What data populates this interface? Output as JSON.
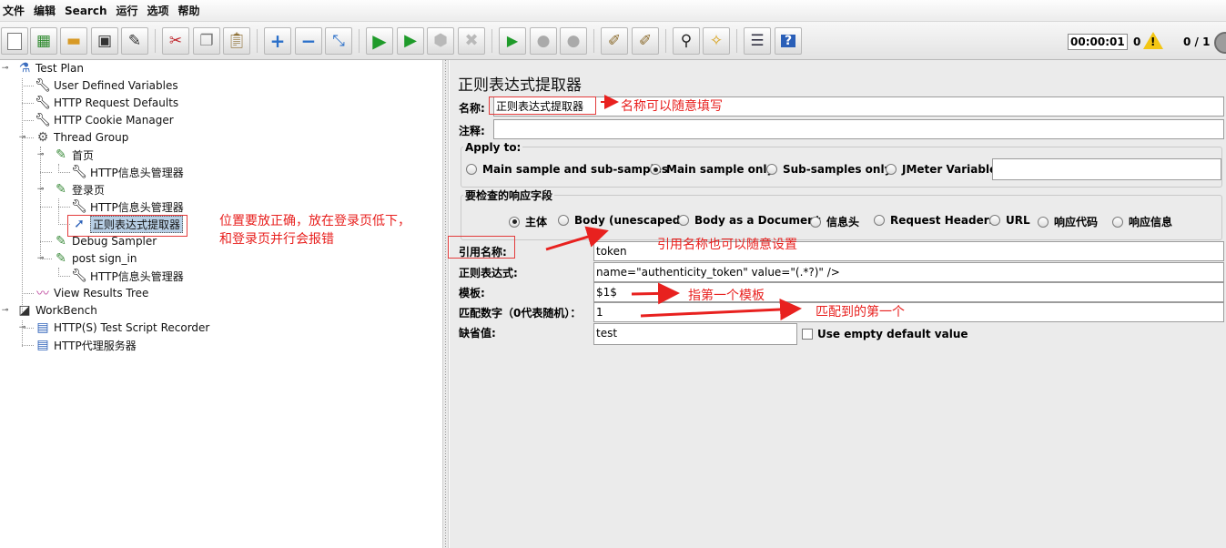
{
  "menu": [
    "文件",
    "编辑",
    "Search",
    "运行",
    "选项",
    "帮助"
  ],
  "toolbar": {
    "icons": [
      "new-icon",
      "templates-icon",
      "open-icon",
      "save-icon",
      "save-as-icon",
      "cut-icon",
      "copy-icon",
      "paste-icon",
      "expand-icon",
      "collapse-icon",
      "toggle-icon",
      "start-icon",
      "start-no-pauses-icon",
      "stop-icon",
      "shutdown-icon",
      "remote-start-icon",
      "remote-stop-icon",
      "remote-shutdown-icon",
      "clear-icon",
      "clear-all-icon",
      "search-icon",
      "reset-search-icon",
      "function-helper-icon",
      "help-icon"
    ],
    "timer": "00:00:01",
    "warnings": "0",
    "threads": "0 / 1"
  },
  "tree": [
    {
      "label": "Test Plan",
      "icon": "test-plan-icon"
    },
    {
      "label": "User Defined Variables",
      "icon": "wrench-icon"
    },
    {
      "label": "HTTP Request Defaults",
      "icon": "wrench-icon"
    },
    {
      "label": "HTTP Cookie Manager",
      "icon": "wrench-icon"
    },
    {
      "label": "Thread Group",
      "icon": "gear-icon"
    },
    {
      "label": "首页",
      "icon": "sampler-icon"
    },
    {
      "label": "HTTP信息头管理器",
      "icon": "wrench-icon"
    },
    {
      "label": "登录页",
      "icon": "sampler-icon"
    },
    {
      "label": "HTTP信息头管理器",
      "icon": "wrench-icon"
    },
    {
      "label": "正则表达式提取器",
      "icon": "extractor-icon"
    },
    {
      "label": "Debug Sampler",
      "icon": "sampler-icon"
    },
    {
      "label": "post sign_in",
      "icon": "sampler-icon"
    },
    {
      "label": "HTTP信息头管理器",
      "icon": "wrench-icon"
    },
    {
      "label": "View Results Tree",
      "icon": "graph-icon"
    },
    {
      "label": "WorkBench",
      "icon": "workbench-icon"
    },
    {
      "label": "HTTP(S) Test Script Recorder",
      "icon": "recorder-icon"
    },
    {
      "label": "HTTP代理服务器",
      "icon": "recorder-icon"
    }
  ],
  "panel": {
    "title": "正则表达式提取器",
    "name_label": "名称:",
    "name_value": "正则表达式提取器",
    "comment_label": "注释:",
    "comment_value": "",
    "apply_to": {
      "title": "Apply to:",
      "options": [
        "Main sample and sub-samples",
        "Main sample only",
        "Sub-samples only",
        "JMeter Variable"
      ],
      "selected": 1,
      "variable_value": ""
    },
    "field_to_check": {
      "title": "要检查的响应字段",
      "options": [
        "主体",
        "Body (unescaped)",
        "Body as a Document",
        "信息头",
        "Request Headers",
        "URL",
        "响应代码",
        "响应信息"
      ],
      "selected": 0
    },
    "ref_name_label": "引用名称:",
    "ref_name_value": "token",
    "regex_label": "正则表达式:",
    "regex_value": "name=\"authenticity_token\" value=\"(.*?)\" />",
    "template_label": "模板:",
    "template_value": "$1$",
    "match_no_label": "匹配数字（0代表随机）：",
    "match_no_value": "1",
    "default_label": "缺省值:",
    "default_value": "test",
    "use_empty_label": "Use empty default value"
  },
  "annotations": {
    "name_note": "名称可以随意填写",
    "position_note_line1": "位置要放正确，放在登录页低下，",
    "position_note_line2": "和登录页并行会报错",
    "ref_note": "引用名称也可以随意设置",
    "template_note": "指第一个模板",
    "match_note": "匹配到的第一个"
  },
  "colors": {
    "annotation": "#e8211f",
    "selection": "#b8cfe5",
    "panel_bg": "#ebebeb"
  }
}
